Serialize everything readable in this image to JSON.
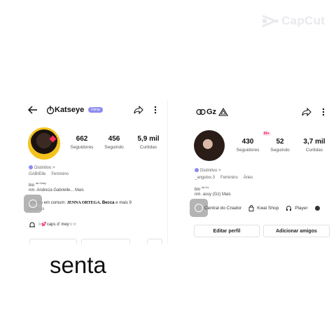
{
  "watermark": {
    "text": "CapCut",
    "icon": "capcut-logo-icon"
  },
  "left_profile": {
    "username": "Katseye",
    "pill": "Fãnia",
    "stats": [
      {
        "value": "662",
        "label": "Seguidores"
      },
      {
        "value": "456",
        "label": "Seguindo"
      },
      {
        "value": "5,9 mil",
        "label": "Curtidas"
      }
    ],
    "badge": "Distintivo >",
    "meta1": "GABIElle",
    "meta2": "Feminino",
    "bio_label": "bio",
    "bio_sup": "da Gaby",
    "bio_line": "nm. Andreza Gabrielle...",
    "more": "Mais",
    "mutual_prefix": "Amigos em comum:",
    "mutual_name": "JENNA ORTEGA.",
    "mutual_name2": "Becca",
    "mutual_suffix": "e mais 9",
    "mutual_tail": "pessoas",
    "caps_line": "☆💕caps d' mey☆☆"
  },
  "right_profile": {
    "username": "Gz",
    "stats": [
      {
        "value": "430",
        "label": "Seguidores",
        "notif": "99+"
      },
      {
        "value": "52",
        "label": "Seguindo"
      },
      {
        "value": "3,7 mil",
        "label": "Curtidas"
      }
    ],
    "badge": "Distintivo >",
    "meta1": "_angelxx.3",
    "meta2": "Feminino",
    "meta3": "Áries",
    "bio_label": "bio",
    "bio_sup": "da Gz",
    "bio_line": "nm. assy (Gz)",
    "more": "Mais",
    "shortcuts": [
      {
        "label": "Central do Criador",
        "icon": "creator-center-icon"
      },
      {
        "label": "Kwai Shop",
        "icon": "shopping-bag-icon"
      },
      {
        "label": "Player",
        "icon": "headphones-icon"
      }
    ],
    "edit_button": "Editar perfil",
    "add_button": "Adicionar amigos"
  },
  "caption": "senta"
}
